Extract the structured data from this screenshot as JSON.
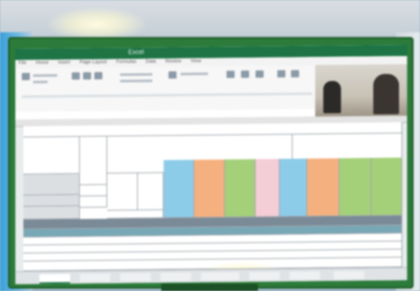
{
  "app": {
    "title": "Excel",
    "accent_color": "#217346"
  },
  "ribbon": {
    "tabs": [
      "File",
      "Home",
      "Insert",
      "Page Layout",
      "Formulas",
      "Data",
      "Review",
      "View"
    ]
  },
  "sheet": {
    "header_row": [
      "",
      "",
      "",
      "",
      "",
      "",
      "",
      "",
      "",
      "",
      "",
      ""
    ],
    "colored_columns": [
      "blue",
      "orange",
      "green",
      "pink",
      "blue",
      "orange",
      "green",
      "green"
    ]
  },
  "sheet_tabs": [
    "",
    "",
    "",
    "",
    "",
    "",
    "",
    ""
  ]
}
